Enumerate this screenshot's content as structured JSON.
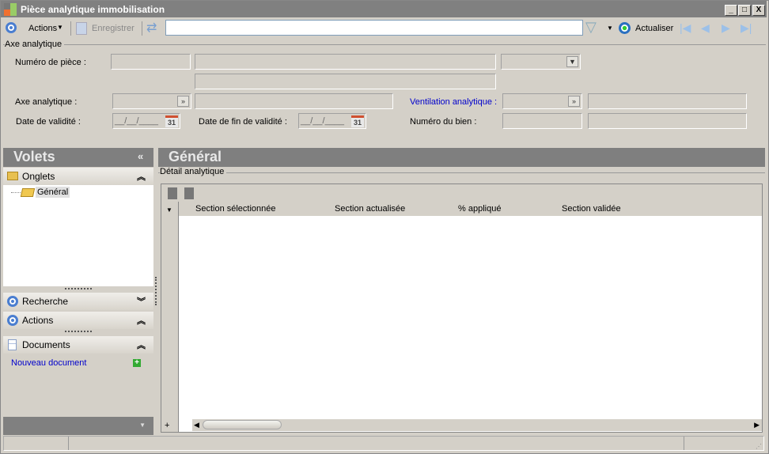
{
  "window": {
    "title": "Pièce analytique immobilisation",
    "minimize": "_",
    "maximize": "□",
    "close": "X"
  },
  "toolbar": {
    "actions_label": "Actions",
    "save_label": "Enregistrer",
    "search_value": "",
    "refresh_label": "Actualiser"
  },
  "form": {
    "group_label": "Axe analytique",
    "piece_number_label": "Numéro de pièce :",
    "axis_label": "Axe analytique :",
    "ventilation_label": "Ventilation analytique :",
    "validity_date_label": "Date de validité :",
    "validity_date_value": "__/__/____",
    "end_validity_date_label": "Date de fin de validité :",
    "end_validity_date_value": "__/__/____",
    "asset_number_label": "Numéro du bien :",
    "calendar_day": "31"
  },
  "sidebar": {
    "title": "Volets",
    "collapse": "«",
    "tabs_section": "Onglets",
    "tree_item": "Général",
    "search_section": "Recherche",
    "actions_section": "Actions",
    "documents_section": "Documents",
    "new_document": "Nouveau document"
  },
  "main": {
    "title": "Général",
    "group_label": "Détail analytique",
    "columns": [
      "Section sélectionnée",
      "Section actualisée",
      "% appliqué",
      "Section validée"
    ],
    "add_row": "+"
  },
  "colors": {
    "link": "#0000cc",
    "header": "#7f7f7f"
  }
}
